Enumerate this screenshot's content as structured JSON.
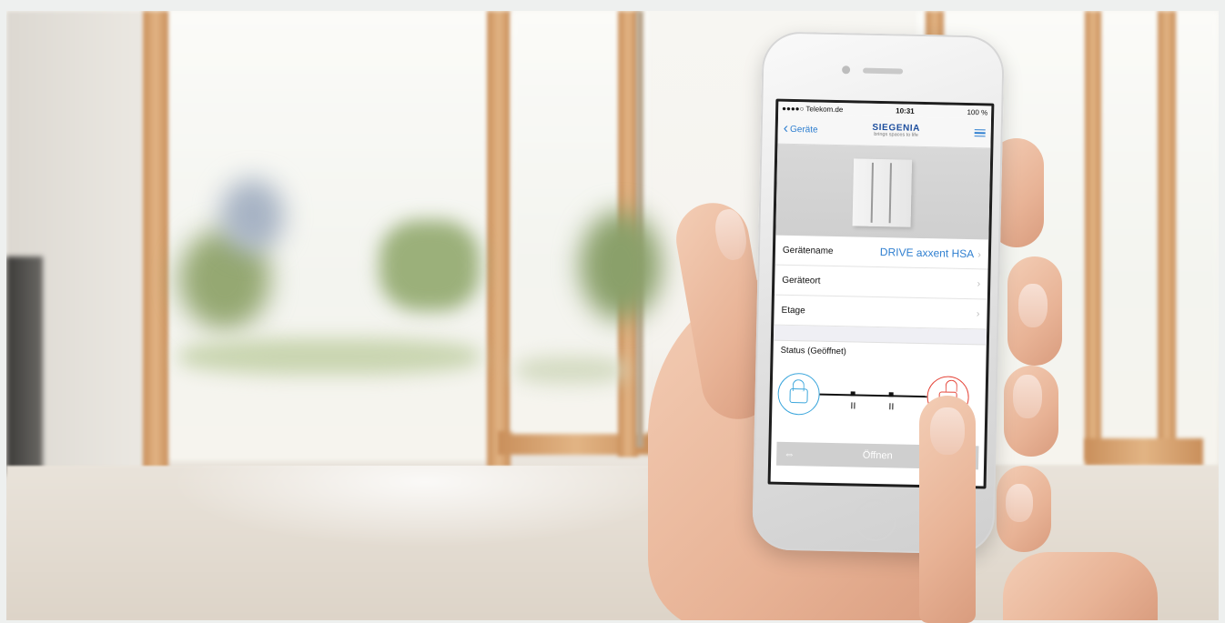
{
  "phone": {
    "status_bar": {
      "carrier": "●●●●○ Telekom.de",
      "time": "10:31",
      "battery": "100 %"
    },
    "nav": {
      "back_label": "Geräte",
      "brand": "SIEGENIA",
      "tagline": "brings spaces to life"
    },
    "rows": [
      {
        "label": "Gerätename",
        "value": "DRIVE axxent HSA"
      },
      {
        "label": "Geräteort",
        "value": ""
      },
      {
        "label": "Etage",
        "value": ""
      }
    ],
    "status_label": "Status (Geöffnet)",
    "action_label": "Öffnen"
  },
  "colors": {
    "accent_blue": "#2f7fd0",
    "lock_closed": "#3ba6dc",
    "lock_open": "#e5463a",
    "brand_blue": "#1e4f9e"
  },
  "icons": [
    "back-chevron-icon",
    "menu-icon",
    "padlock-closed-icon",
    "padlock-open-icon",
    "swap-arrows-icon"
  ]
}
